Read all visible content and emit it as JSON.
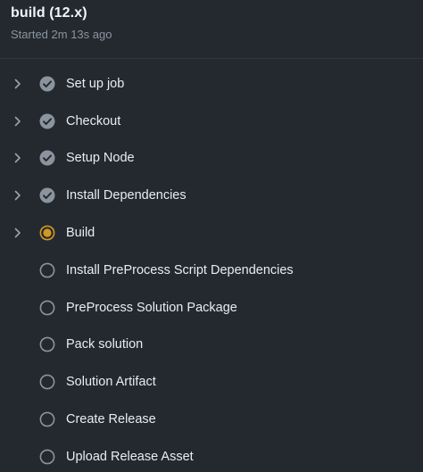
{
  "job": {
    "title": "build (12.x)",
    "subtitle": "Started 2m 13s ago"
  },
  "colors": {
    "background": "#24292f",
    "success_circle": "#8b949e",
    "in_progress": "#d29922",
    "pending_ring": "#8b949e"
  },
  "steps": [
    {
      "label": "Set up job",
      "status": "success",
      "expandable": true,
      "icon": "check-circle-icon"
    },
    {
      "label": "Checkout",
      "status": "success",
      "expandable": true,
      "icon": "check-circle-icon"
    },
    {
      "label": "Setup Node",
      "status": "success",
      "expandable": true,
      "icon": "check-circle-icon"
    },
    {
      "label": "Install Dependencies",
      "status": "success",
      "expandable": true,
      "icon": "check-circle-icon"
    },
    {
      "label": "Build",
      "status": "in_progress",
      "expandable": true,
      "icon": "in-progress-icon"
    },
    {
      "label": "Install PreProcess Script Dependencies",
      "status": "queued",
      "expandable": false,
      "icon": "pending-circle-icon"
    },
    {
      "label": "PreProcess Solution Package",
      "status": "queued",
      "expandable": false,
      "icon": "pending-circle-icon"
    },
    {
      "label": "Pack solution",
      "status": "queued",
      "expandable": false,
      "icon": "pending-circle-icon"
    },
    {
      "label": "Solution Artifact",
      "status": "queued",
      "expandable": false,
      "icon": "pending-circle-icon"
    },
    {
      "label": "Create Release",
      "status": "queued",
      "expandable": false,
      "icon": "pending-circle-icon"
    },
    {
      "label": "Upload Release Asset",
      "status": "queued",
      "expandable": false,
      "icon": "pending-circle-icon"
    }
  ]
}
